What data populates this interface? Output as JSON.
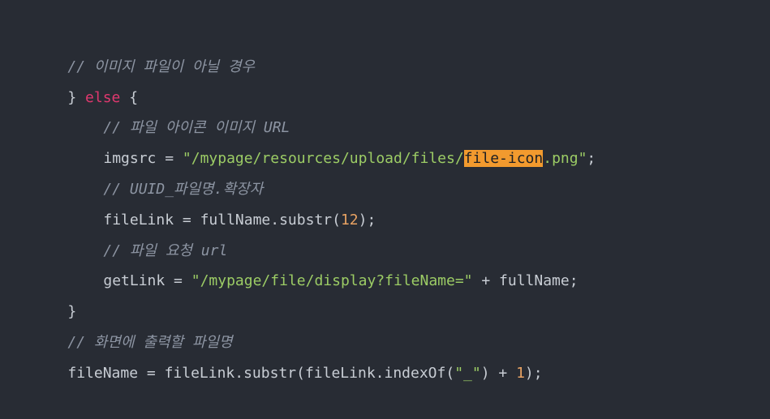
{
  "lines": [
    {
      "indent": 0,
      "tokens": [
        {
          "type": "comment",
          "text": "// 이미지 파일이 아닐 경우"
        }
      ]
    },
    {
      "indent": 0,
      "tokens": [
        {
          "type": "plain",
          "text": "} "
        },
        {
          "type": "kw",
          "text": "else"
        },
        {
          "type": "plain",
          "text": " {"
        }
      ]
    },
    {
      "indent": 1,
      "tokens": [
        {
          "type": "comment",
          "text": "// 파일 아이콘 이미지 URL"
        }
      ]
    },
    {
      "indent": 1,
      "tokens": [
        {
          "type": "plain",
          "text": "imgsrc = "
        },
        {
          "type": "str",
          "text": "\"/mypage/resources/upload/files/"
        },
        {
          "type": "hl",
          "text": "file-icon"
        },
        {
          "type": "str",
          "text": ".png\""
        },
        {
          "type": "plain",
          "text": ";"
        }
      ]
    },
    {
      "indent": 1,
      "tokens": [
        {
          "type": "comment",
          "text": "// UUID_파일명.확장자"
        }
      ]
    },
    {
      "indent": 1,
      "tokens": [
        {
          "type": "plain",
          "text": "fileLink = fullName.substr("
        },
        {
          "type": "num",
          "text": "12"
        },
        {
          "type": "plain",
          "text": ");"
        }
      ]
    },
    {
      "indent": 1,
      "tokens": [
        {
          "type": "comment",
          "text": "// 파일 요청 url"
        }
      ]
    },
    {
      "indent": 1,
      "tokens": [
        {
          "type": "plain",
          "text": "getLink = "
        },
        {
          "type": "str",
          "text": "\"/mypage/file/display?fileName=\""
        },
        {
          "type": "plain",
          "text": " + fullName;"
        }
      ]
    },
    {
      "indent": 0,
      "tokens": [
        {
          "type": "plain",
          "text": "}"
        }
      ]
    },
    {
      "indent": 0,
      "tokens": [
        {
          "type": "comment",
          "text": "// 화면에 출력할 파일명"
        }
      ]
    },
    {
      "indent": 0,
      "tokens": [
        {
          "type": "plain",
          "text": "fileName = fileLink.substr(fileLink.indexOf("
        },
        {
          "type": "str",
          "text": "\"_\""
        },
        {
          "type": "plain",
          "text": ") + "
        },
        {
          "type": "num",
          "text": "1"
        },
        {
          "type": "plain",
          "text": ");"
        }
      ]
    }
  ],
  "colors": {
    "background": "#282c34",
    "comment": "#8d95a3",
    "keyword": "#e0386e",
    "string": "#9ccc65",
    "number": "#e8a263",
    "highlight": "#f29a2e"
  }
}
